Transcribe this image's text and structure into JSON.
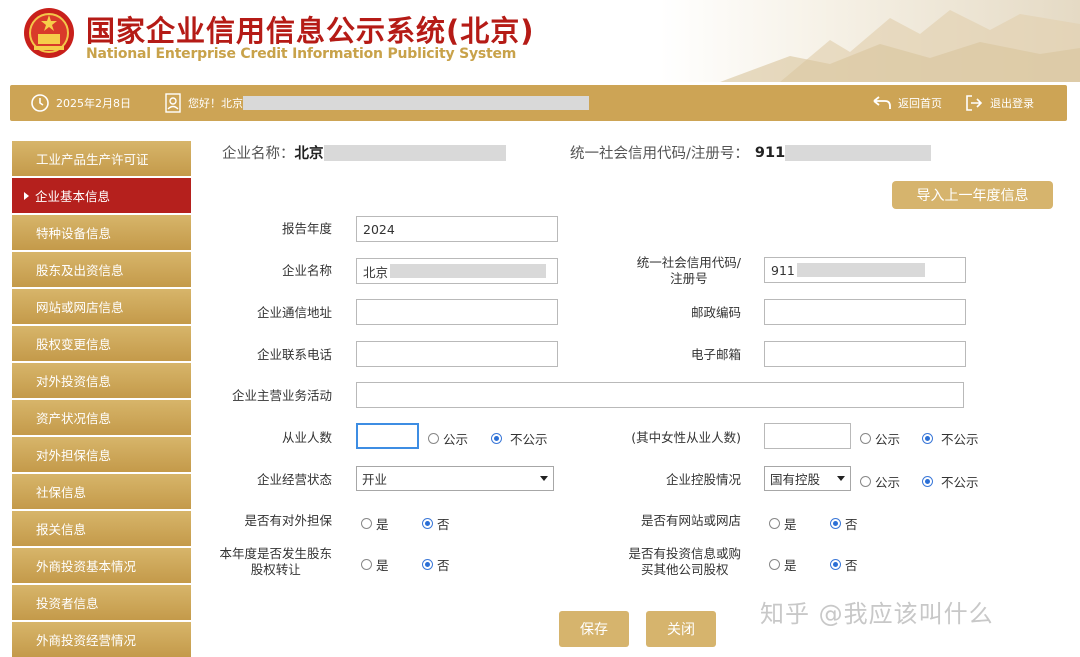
{
  "header": {
    "title": "国家企业信用信息公示系统(北京)",
    "subtitle": "National Enterprise Credit Information Publicity System"
  },
  "topbar": {
    "date": "2025年2月8日",
    "greeting": "您好！北京",
    "home_link": "返回首页",
    "logout_link": "退出登录"
  },
  "sidebar": {
    "items": [
      {
        "label": "工业产品生产许可证"
      },
      {
        "label": "企业基本信息"
      },
      {
        "label": "特种设备信息"
      },
      {
        "label": "股东及出资信息"
      },
      {
        "label": "网站或网店信息"
      },
      {
        "label": "股权变更信息"
      },
      {
        "label": "对外投资信息"
      },
      {
        "label": "资产状况信息"
      },
      {
        "label": "对外担保信息"
      },
      {
        "label": "社保信息"
      },
      {
        "label": "报关信息"
      },
      {
        "label": "外商投资基本情况"
      },
      {
        "label": "投资者信息"
      },
      {
        "label": "外商投资经营情况"
      }
    ]
  },
  "info": {
    "name_label": "企业名称：",
    "name_value": "北京",
    "code_label": "统一社会信用代码/注册号：",
    "code_value": "911"
  },
  "import_button": "导入上一年度信息",
  "form": {
    "report_year_label": "报告年度",
    "report_year_value": "2024",
    "company_name_label": "企业名称",
    "company_name_value": "北京",
    "credit_code_label_1": "统一社会信用代码/",
    "credit_code_label_2": "注册号",
    "credit_code_value": "911",
    "address_label": "企业通信地址",
    "postal_label": "邮政编码",
    "phone_label": "企业联系电话",
    "email_label": "电子邮箱",
    "business_label": "企业主营业务活动",
    "employees_label": "从业人数",
    "female_label": "(其中女性从业人数)",
    "status_label": "企业经营状态",
    "status_value": "开业",
    "holding_label": "企业控股情况",
    "holding_value": "国有控股",
    "guarantee_label": "是否有对外担保",
    "website_label": "是否有网站或网店",
    "equity_transfer_label_1": "本年度是否发生股东",
    "equity_transfer_label_2": "股权转让",
    "investment_label_1": "是否有投资信息或购",
    "investment_label_2": "买其他公司股权",
    "public": "公示",
    "not_public": "不公示",
    "yes": "是",
    "no": "否"
  },
  "buttons": {
    "save": "保存",
    "close": "关闭"
  },
  "watermark": "知乎 @我应该叫什么",
  "colors": {
    "brand_red": "#b51b16",
    "gold": "#cda455",
    "sidebar_active": "#b5201d"
  }
}
